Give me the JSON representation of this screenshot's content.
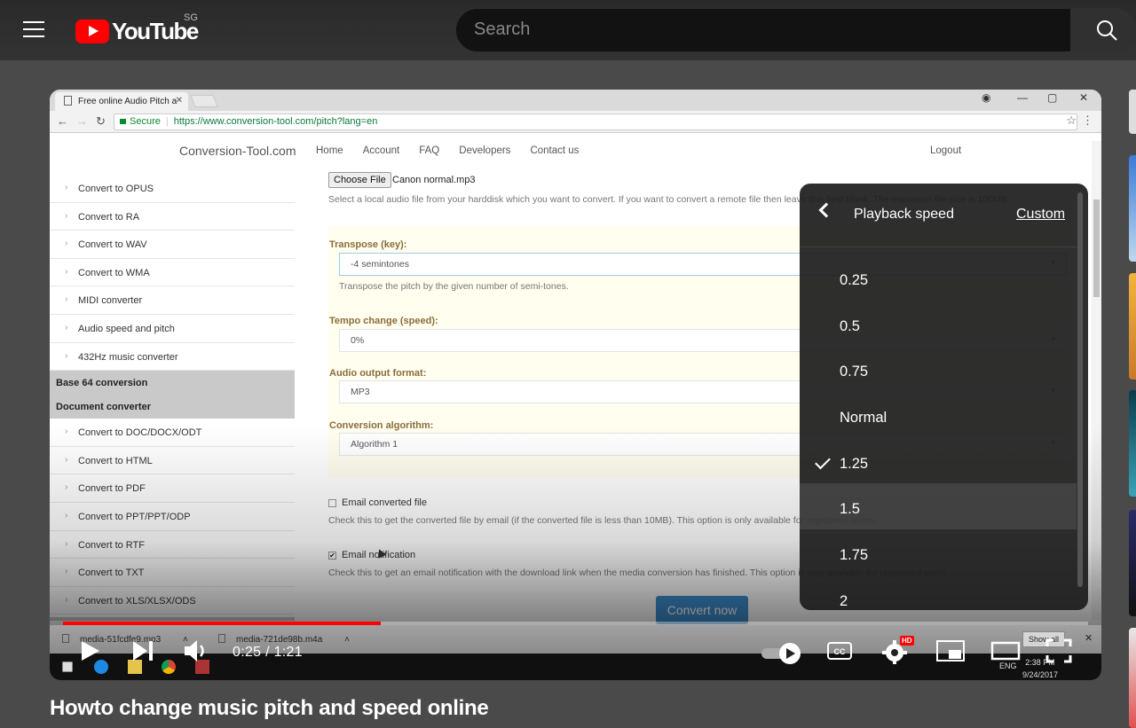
{
  "youtube": {
    "logo_text": "YouTube",
    "country": "SG",
    "search_placeholder": "Search"
  },
  "browser": {
    "tab_title": "Free online Audio Pitch a",
    "secure_label": "Secure",
    "url": "https://www.conversion-tool.com/pitch?lang=en"
  },
  "site": {
    "logo": "Conversion-Tool.com",
    "nav": [
      "Home",
      "Account",
      "FAQ",
      "Developers",
      "Contact us"
    ],
    "logout": "Logout"
  },
  "sidebar": {
    "items_top": [
      "Convert to OPUS",
      "Convert to RA",
      "Convert to WAV",
      "Convert to WMA",
      "MIDI converter",
      "Audio speed and pitch",
      "432Hz music converter"
    ],
    "heading_base64": "Base 64 conversion",
    "heading_document": "Document converter",
    "items_doc": [
      "Convert to DOC/DOCX/ODT",
      "Convert to HTML",
      "Convert to PDF",
      "Convert to PPT/PPT/ODP",
      "Convert to RTF",
      "Convert to TXT",
      "Convert to XLS/XLSX/ODS"
    ]
  },
  "form": {
    "choose_file": "Choose File",
    "file_name": "Canon normal.mp3",
    "file_hint": "Select a local audio file from your harddisk which you want to convert. If you want to convert a remote file then leave this field blank. The maximum file size is 100MB.",
    "transpose_label": "Transpose (key):",
    "transpose_value": "-4 semintones",
    "transpose_hint": "Transpose the pitch by the given number of semi-tones.",
    "tempo_label": "Tempo change (speed):",
    "tempo_value": "0%",
    "format_label": "Audio output format:",
    "format_value": "MP3",
    "algorithm_label": "Conversion algorithm:",
    "algorithm_value": "Algorithm 1",
    "email_file_label": "Email converted file",
    "email_file_checked": false,
    "email_file_hint": "Check this to get the converted file by email (if the converted file is less than 10MB). This option is only available for registered users.",
    "email_notify_label": "Email notification",
    "email_notify_checked": true,
    "email_notify_hint": "Check this to get an email notification with the download link when the media conversion has finished. This option is only available for registered users.",
    "convert_button": "Convert now"
  },
  "downloads": {
    "files": [
      "media-51fcdfe9.mp3",
      "media-721de98b.m4a"
    ],
    "show_all": "Show all"
  },
  "taskbar": {
    "language": "ENG",
    "time": "2:38 PM",
    "date": "9/24/2017"
  },
  "player": {
    "current_time": "0:25",
    "duration": "1:21",
    "time_display": "0:25 / 1:21",
    "progress": 0.31,
    "hd_badge": "HD"
  },
  "speed_menu": {
    "title": "Playback speed",
    "custom": "Custom",
    "options": [
      "0.25",
      "0.5",
      "0.75",
      "Normal",
      "1.25",
      "1.5",
      "1.75",
      "2"
    ],
    "selected": "1.25",
    "hovered": "1.5"
  },
  "video_title": "Howto change music pitch and speed online",
  "colors": {
    "youtube_red": "#ff0000",
    "label_brown": "#8a6d3b",
    "convert_blue": "#3d8fd0"
  }
}
